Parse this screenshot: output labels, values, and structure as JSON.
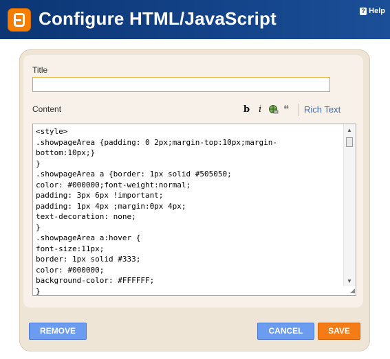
{
  "header": {
    "title": "Configure HTML/JavaScript",
    "help_label": "Help"
  },
  "form": {
    "title_label": "Title",
    "title_value": "",
    "content_label": "Content",
    "toolbar": {
      "bold": "b",
      "italic": "i",
      "quote": "❝",
      "rich_text_label": "Rich Text"
    },
    "content_lines": [
      "<style>",
      ".showpageArea {padding: 0 2px;margin-top:10px;margin-",
      "bottom:10px;}",
      "}",
      ".showpageArea a {border: 1px solid #505050;",
      "color: #000000;font-weight:normal;",
      "padding: 3px 6px !important;",
      "padding: 1px 4px ;margin:0px 4px;",
      "text-decoration: none;",
      "}",
      ".showpageArea a:hover {",
      "font-size:11px;",
      "border: 1px solid #333;",
      "color: #000000;",
      "background-color: #FFFFFF;",
      "}"
    ]
  },
  "actions": {
    "remove": "REMOVE",
    "cancel": "CANCEL",
    "save": "SAVE"
  },
  "colors": {
    "header_bg": "#0f3a78",
    "accent_orange": "#f47b16",
    "button_blue": "#6c9cf0",
    "panel_bg": "#efe5d7"
  }
}
